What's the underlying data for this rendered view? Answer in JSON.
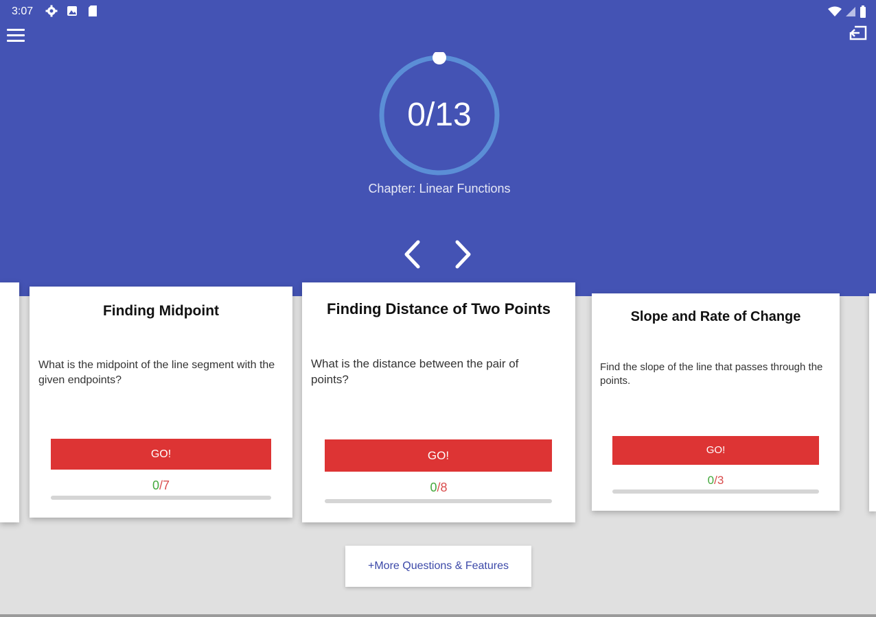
{
  "status_bar": {
    "time": "3:07",
    "left_icons": [
      "settings-icon",
      "photo-notification-icon",
      "sd-card-icon"
    ],
    "right_icons": [
      "wifi-icon",
      "signal-icon",
      "battery-icon"
    ]
  },
  "toolbar": {
    "menu_icon": "hamburger-menu-icon",
    "exit_icon": "exit-icon"
  },
  "progress": {
    "label": "0/13",
    "completed": 0,
    "total": 13,
    "ring_color": "#5b8ed6"
  },
  "chapter": "Chapter: Linear Functions",
  "navigation": {
    "prev_icon": "chevron-left-icon",
    "next_icon": "chevron-right-icon"
  },
  "cards": [
    {
      "title": "Finding Midpoint",
      "description": "What is the midpoint of the line segment with the given endpoints?",
      "button": "GO!",
      "done": "0",
      "separator": "/",
      "total": "7",
      "progress_fraction": 0
    },
    {
      "title": "Finding Distance of Two Points",
      "description": "What is the distance between the pair of points?",
      "button": "GO!",
      "done": "0",
      "separator": "/",
      "total": "8",
      "progress_fraction": 0
    },
    {
      "title": "Slope and Rate of Change",
      "description": "Find the slope of the line that passes through the points.",
      "button": "GO!",
      "done": "0",
      "separator": "/",
      "total": "3",
      "progress_fraction": 0
    }
  ],
  "more_button": "+More Questions & Features",
  "colors": {
    "header": "#4453b4",
    "go_button": "#dd3434",
    "done": "#43a83c",
    "total": "#d94c4c",
    "more_text": "#3b48a8"
  }
}
